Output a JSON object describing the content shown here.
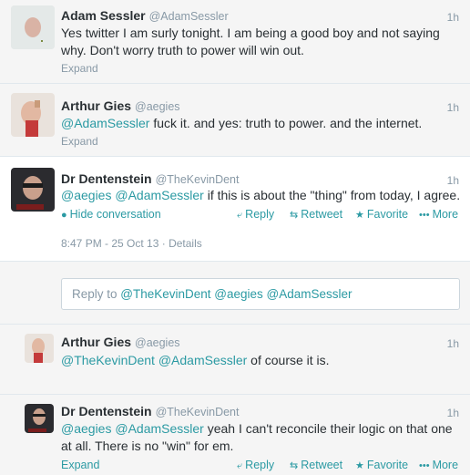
{
  "tweets": [
    {
      "name": "Adam Sessler",
      "handle": "@AdamSessler",
      "time": "1h",
      "line1": "Yes twitter I am surly tonight.  I am being a good boy and not saying",
      "line2": "why.  Don't worry truth to power will win out.",
      "expand": "Expand"
    },
    {
      "name": "Arthur Gies",
      "handle": "@aegies",
      "time": "1h",
      "mention1": "@AdamSessler",
      "rest": " fuck it. and yes: truth to power. and the internet.",
      "expand": "Expand"
    },
    {
      "name": "Dr Dentenstein",
      "handle": "@TheKevinDent",
      "time": "1h",
      "mention1": "@aegies",
      "mention2": "@AdamSessler",
      "rest": " if this is about the \"thing\" from today, I agree.",
      "hide": "Hide conversation",
      "reply": "Reply",
      "retweet": "Retweet",
      "favorite": "Favorite",
      "more": "More",
      "timestamp": "8:47 PM - 25 Oct 13",
      "details": "Details"
    },
    {
      "name": "Arthur Gies",
      "handle": "@aegies",
      "time": "1h",
      "mention1": "@TheKevinDent",
      "mention2": "@AdamSessler",
      "rest": " of course it is."
    },
    {
      "name": "Dr Dentenstein",
      "handle": "@TheKevinDent",
      "time": "1h",
      "mention1": "@aegies",
      "mention2": "@AdamSessler",
      "rest1": " yeah I can't reconcile their logic on that one",
      "line2": "at all. There is no \"win\" for em.",
      "expand": "Expand",
      "reply": "Reply",
      "retweet": "Retweet",
      "favorite": "Favorite",
      "more": "More"
    }
  ],
  "reply_box": {
    "prefix": "Reply to ",
    "mentions": "@TheKevinDent @aegies @AdamSessler"
  },
  "colors": {
    "link": "#2b9aa3",
    "muted": "#8899a6",
    "text": "#292f33",
    "background": "#f5f5f5"
  }
}
